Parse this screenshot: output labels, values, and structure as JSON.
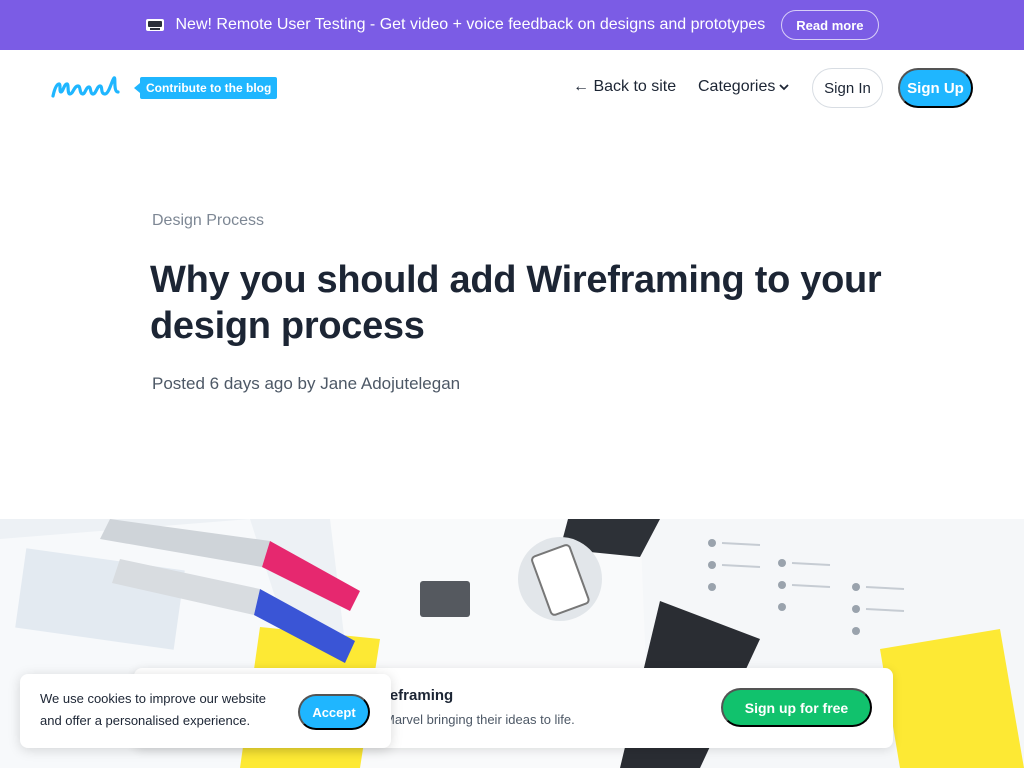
{
  "announcement": {
    "text": "New! Remote User Testing - Get video + voice feedback on designs and prototypes",
    "read_more": "Read more",
    "icon": "megaphone-icon"
  },
  "header": {
    "logo_text": "Marvel",
    "contribute": "Contribute to the blog",
    "back_to_site": "← Back to site",
    "categories": "Categories",
    "sign_in": "Sign In",
    "sign_up": "Sign Up"
  },
  "article": {
    "category": "Design Process",
    "title": "Why you should add Wireframing to your design process",
    "byline": "Posted 6 days ago by Jane Adojutelegan"
  },
  "cta": {
    "title": "reframing",
    "subtitle": "Marvel bringing their ideas to life.",
    "button": "Sign up for free"
  },
  "cookie": {
    "text": "We use cookies to improve our website and offer a personalised experience.",
    "accept": "Accept"
  },
  "colors": {
    "announcement_bg": "#7b5ce5",
    "brand_blue": "#1fb6ff",
    "cta_green": "#11c26d",
    "text_dark": "#1c2534"
  }
}
